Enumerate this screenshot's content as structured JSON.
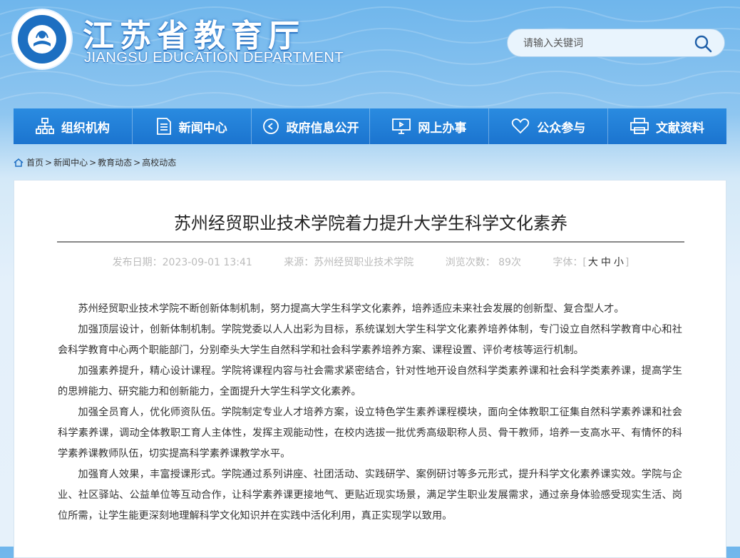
{
  "header": {
    "title": "江苏省教育厅",
    "subtitle": "JIANGSU EDUCATION DEPARTMENT",
    "search_placeholder": "请输入关键词"
  },
  "nav": [
    {
      "label": "组织机构",
      "icon": "org-chart-icon"
    },
    {
      "label": "新闻中心",
      "icon": "document-icon"
    },
    {
      "label": "政府信息公开",
      "icon": "play-circle-icon"
    },
    {
      "label": "网上办事",
      "icon": "monitor-icon"
    },
    {
      "label": "公众参与",
      "icon": "heart-icon"
    },
    {
      "label": "文献资料",
      "icon": "printer-icon"
    }
  ],
  "breadcrumb": [
    "首页",
    "新闻中心",
    "教育动态",
    "高校动态"
  ],
  "article": {
    "title": "苏州经贸职业技术学院着力提升大学生科学文化素养",
    "date": "发布日期：2023-09-01 13:41",
    "source": "来源：苏州经贸职业技术学院",
    "views": "浏览次数：  89次",
    "font_label": "字体：",
    "font_sizes": [
      "大",
      "中",
      "小"
    ],
    "paragraphs": [
      "苏州经贸职业技术学院不断创新体制机制，努力提高大学生科学文化素养，培养适应未来社会发展的创新型、复合型人才。",
      "加强顶层设计，创新体制机制。学院党委以人人出彩为目标，系统谋划大学生科学文化素养培养体制，专门设立自然科学教育中心和社会科学教育中心两个职能部门，分别牵头大学生自然科学和社会科学素养培养方案、课程设置、评价考核等运行机制。",
      "加强素养提升，精心设计课程。学院将课程内容与社会需求紧密结合，针对性地开设自然科学类素养课和社会科学类素养课，提高学生的思辨能力、研究能力和创新能力，全面提升大学生科学文化素养。",
      "加强全员育人，优化师资队伍。学院制定专业人才培养方案，设立特色学生素养课程模块，面向全体教职工征集自然科学素养课和社会科学素养课，调动全体教职工育人主体性，发挥主观能动性，在校内选拔一批优秀高级职称人员、骨干教师，培养一支高水平、有情怀的科学素养课教师队伍，切实提高科学素养课教学水平。",
      "加强育人效果，丰富授课形式。学院通过系列讲座、社团活动、实践研学、案例研讨等多元形式，提升科学文化素养课实效。学院与企业、社区驿站、公益单位等互动合作，让科学素养课更接地气、更贴近现实场景，满足学生职业发展需求，通过亲身体验感受现实生活、岗位所需，让学生能更深刻地理解科学文化知识并在实践中活化利用，真正实现学以致用。"
    ]
  }
}
